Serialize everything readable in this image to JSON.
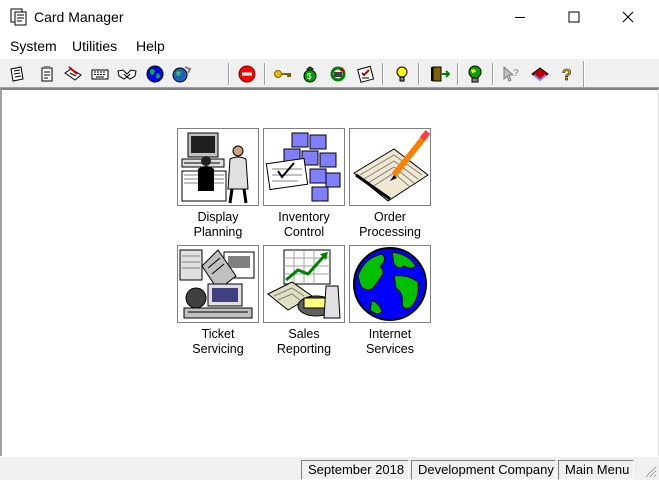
{
  "window": {
    "title": "Card Manager",
    "icon": "card-manager-app-icon"
  },
  "menu": {
    "items": [
      {
        "label": "System"
      },
      {
        "label": "Utilities"
      },
      {
        "label": "Help"
      }
    ]
  },
  "toolbar": {
    "icons": [
      "notebook-icon",
      "clipboard-icon",
      "pencil-card-icon",
      "keyboard-icon",
      "handshake-icon",
      "globe-icon",
      "network-globe-icon",
      "stop-icon",
      "key-icon",
      "money-bag-icon",
      "recycle-icon",
      "checklist-icon",
      "lightbulb-icon",
      "exit-door-icon",
      "globe-person-icon",
      "help-pointer-icon",
      "book-icon",
      "question-mark-icon"
    ]
  },
  "modules": [
    {
      "line1": "Display",
      "line2": "Planning",
      "icon": "display-planning-icon"
    },
    {
      "line1": "Inventory",
      "line2": "Control",
      "icon": "inventory-control-icon"
    },
    {
      "line1": "Order",
      "line2": "Processing",
      "icon": "order-processing-icon"
    },
    {
      "line1": "Ticket",
      "line2": "Servicing",
      "icon": "ticket-servicing-icon"
    },
    {
      "line1": "Sales",
      "line2": "Reporting",
      "icon": "sales-reporting-icon"
    },
    {
      "line1": "Internet",
      "line2": "Services",
      "icon": "internet-services-icon"
    }
  ],
  "status": {
    "date": "September 2018",
    "company": "Development Company",
    "screen": "Main Menu"
  },
  "colors": {
    "toolbar_bg": "#f0f0f0",
    "stop_red": "#ff0000",
    "globe_blue": "#0000ff",
    "globe_green": "#00c000"
  }
}
